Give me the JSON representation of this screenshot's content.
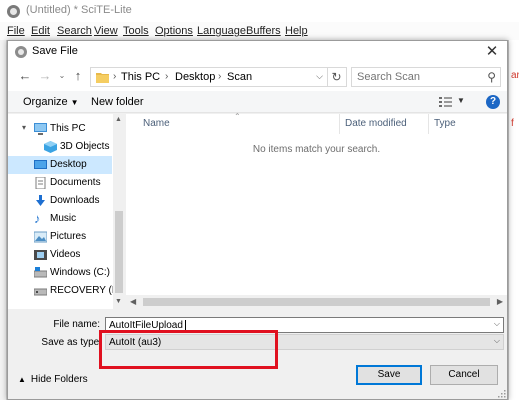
{
  "app": {
    "title": "(Untitled) * SciTE-Lite",
    "menu": [
      "File",
      "Edit",
      "Search",
      "View",
      "Tools",
      "Options",
      "Language",
      "Buffers",
      "Help"
    ],
    "side_fragment_1": "ar",
    "side_fragment_2": "f"
  },
  "dialog": {
    "title": "Save File",
    "close_glyph": "✕",
    "breadcrumb": [
      "This PC",
      "Desktop",
      "Scan"
    ],
    "search_placeholder": "Search Scan",
    "toolbar": {
      "organize_label": "Organize",
      "new_folder_label": "New folder",
      "help_glyph": "?"
    },
    "nav_items": [
      {
        "label": "This PC",
        "icon": "this-pc-icon"
      },
      {
        "label": "3D Objects",
        "icon": "3d-objects-icon"
      },
      {
        "label": "Desktop",
        "icon": "desktop-icon",
        "selected": true
      },
      {
        "label": "Documents",
        "icon": "documents-icon"
      },
      {
        "label": "Downloads",
        "icon": "downloads-icon"
      },
      {
        "label": "Music",
        "icon": "music-icon"
      },
      {
        "label": "Pictures",
        "icon": "pictures-icon"
      },
      {
        "label": "Videos",
        "icon": "videos-icon"
      },
      {
        "label": "Windows (C:)",
        "icon": "drive-icon"
      },
      {
        "label": "RECOVERY (D:)",
        "icon": "drive-icon"
      }
    ],
    "columns": [
      "Name",
      "Date modified",
      "Type"
    ],
    "empty_message": "No items match your search.",
    "file_name_label": "File name:",
    "file_name_value": "AutoItFileUpload",
    "save_as_type_label": "Save as type:",
    "save_as_type_value": "AutoIt (au3)",
    "hide_folders_label": "Hide Folders",
    "save_label": "Save",
    "cancel_label": "Cancel"
  },
  "colors": {
    "selection": "#cce8ff",
    "help_blue": "#1c67c5",
    "annotation_red": "#e0101f",
    "primary_button_border": "#0078d7"
  }
}
